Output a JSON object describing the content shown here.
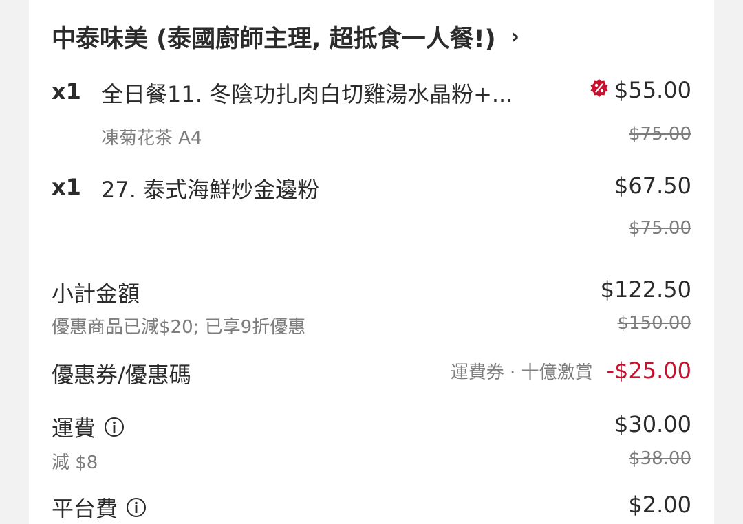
{
  "restaurant": {
    "name": "中泰味美 (泰國廚師主理, 超抵食一人餐!)",
    "chevron": "›"
  },
  "items": [
    {
      "qty": "x1",
      "name": "全日餐11. 冬陰功扎肉白切雞湯水晶粉+...",
      "option": "凍菊花茶 A4",
      "price": "$55.00",
      "original_price": "$75.00",
      "badge_icon": "discount-badge-icon"
    },
    {
      "qty": "x1",
      "name": "27. 泰式海鮮炒金邊粉",
      "option": "",
      "price": "$67.50",
      "original_price": "$75.00"
    }
  ],
  "subtotal": {
    "label": "小計金額",
    "note": "優惠商品已減$20; 已享9折優惠",
    "amount": "$122.50",
    "original": "$150.00"
  },
  "voucher": {
    "label": "優惠券/優惠碼",
    "name": "運費券 · 十億激賞",
    "amount": "-$25.00"
  },
  "delivery_fee": {
    "label": "運費",
    "note": "減 $8",
    "amount": "$30.00",
    "original": "$38.00"
  },
  "platform_fee": {
    "label": "平台費",
    "amount": "$2.00"
  },
  "colors": {
    "accent_red": "#c8102e",
    "text_dark": "#2b2b2b",
    "text_muted": "#7d7d7d",
    "background": "#f2f2f2"
  }
}
